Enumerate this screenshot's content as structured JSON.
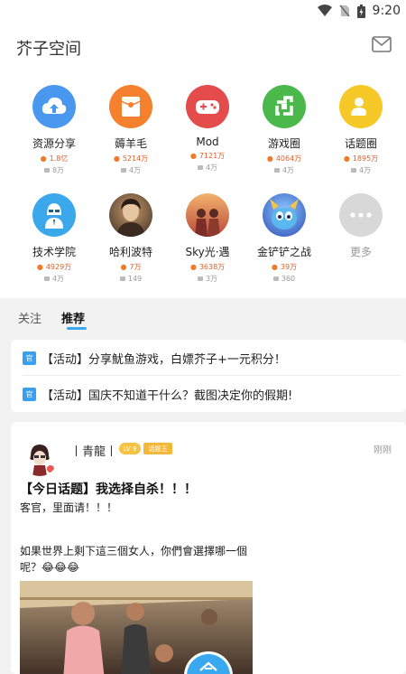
{
  "status": {
    "time": "9:20"
  },
  "header": {
    "title": "芥子空间"
  },
  "categories": [
    {
      "name": "资源分享",
      "hot": "1.8亿",
      "posts": "8万",
      "color": "#4a97f0",
      "icon": "cloud-upload-icon"
    },
    {
      "name": "薅羊毛",
      "hot": "5214万",
      "posts": "4万",
      "color": "#f5802d",
      "icon": "red-envelope-icon"
    },
    {
      "name": "Mod",
      "hot": "7121万",
      "posts": "4万",
      "color": "#e44b4b",
      "icon": "gamepad-icon"
    },
    {
      "name": "游戏圈",
      "hot": "4064万",
      "posts": "4万",
      "color": "#4ab84a",
      "icon": "game-circle-icon"
    },
    {
      "name": "话题圈",
      "hot": "1895万",
      "posts": "4万",
      "color": "#f7c928",
      "icon": "topic-user-icon"
    },
    {
      "name": "技术学院",
      "hot": "4929万",
      "posts": "4万",
      "color": "#3aa8ea",
      "icon": "hacker-icon"
    },
    {
      "name": "哈利波特",
      "hot": "7万",
      "posts": "149",
      "color": "#5b4a3a",
      "icon": "harry-potter-avatar-icon"
    },
    {
      "name": "Sky光·遇",
      "hot": "3638万",
      "posts": "3万",
      "color": "#d9774a",
      "icon": "sky-avatar-icon"
    },
    {
      "name": "金铲铲之战",
      "hot": "39万",
      "posts": "360",
      "color": "#3f6fd6",
      "icon": "jcc-avatar-icon"
    },
    {
      "name": "更多",
      "hot": "",
      "posts": "",
      "color": "#d8d8d8",
      "icon": "more-icon"
    }
  ],
  "tabs": {
    "follow": "关注",
    "recommend": "推荐"
  },
  "notices": [
    {
      "badge": "官",
      "text": "【活动】分享魷鱼游戏，白嫖芥子+一元积分！"
    },
    {
      "badge": "官",
      "text": "【活动】国庆不知道干什么？截图决定你的假期!"
    }
  ],
  "post": {
    "username": "丨青龍丨",
    "level": "LV 9",
    "tag": "话题王",
    "time": "刚刚",
    "title": "【今日话题】我选择自杀！！！",
    "body": "客官，里面请！！！",
    "image_caption": "如果世界上剩下這三個女人，你們會選擇哪一個呢？😂😂😂"
  }
}
